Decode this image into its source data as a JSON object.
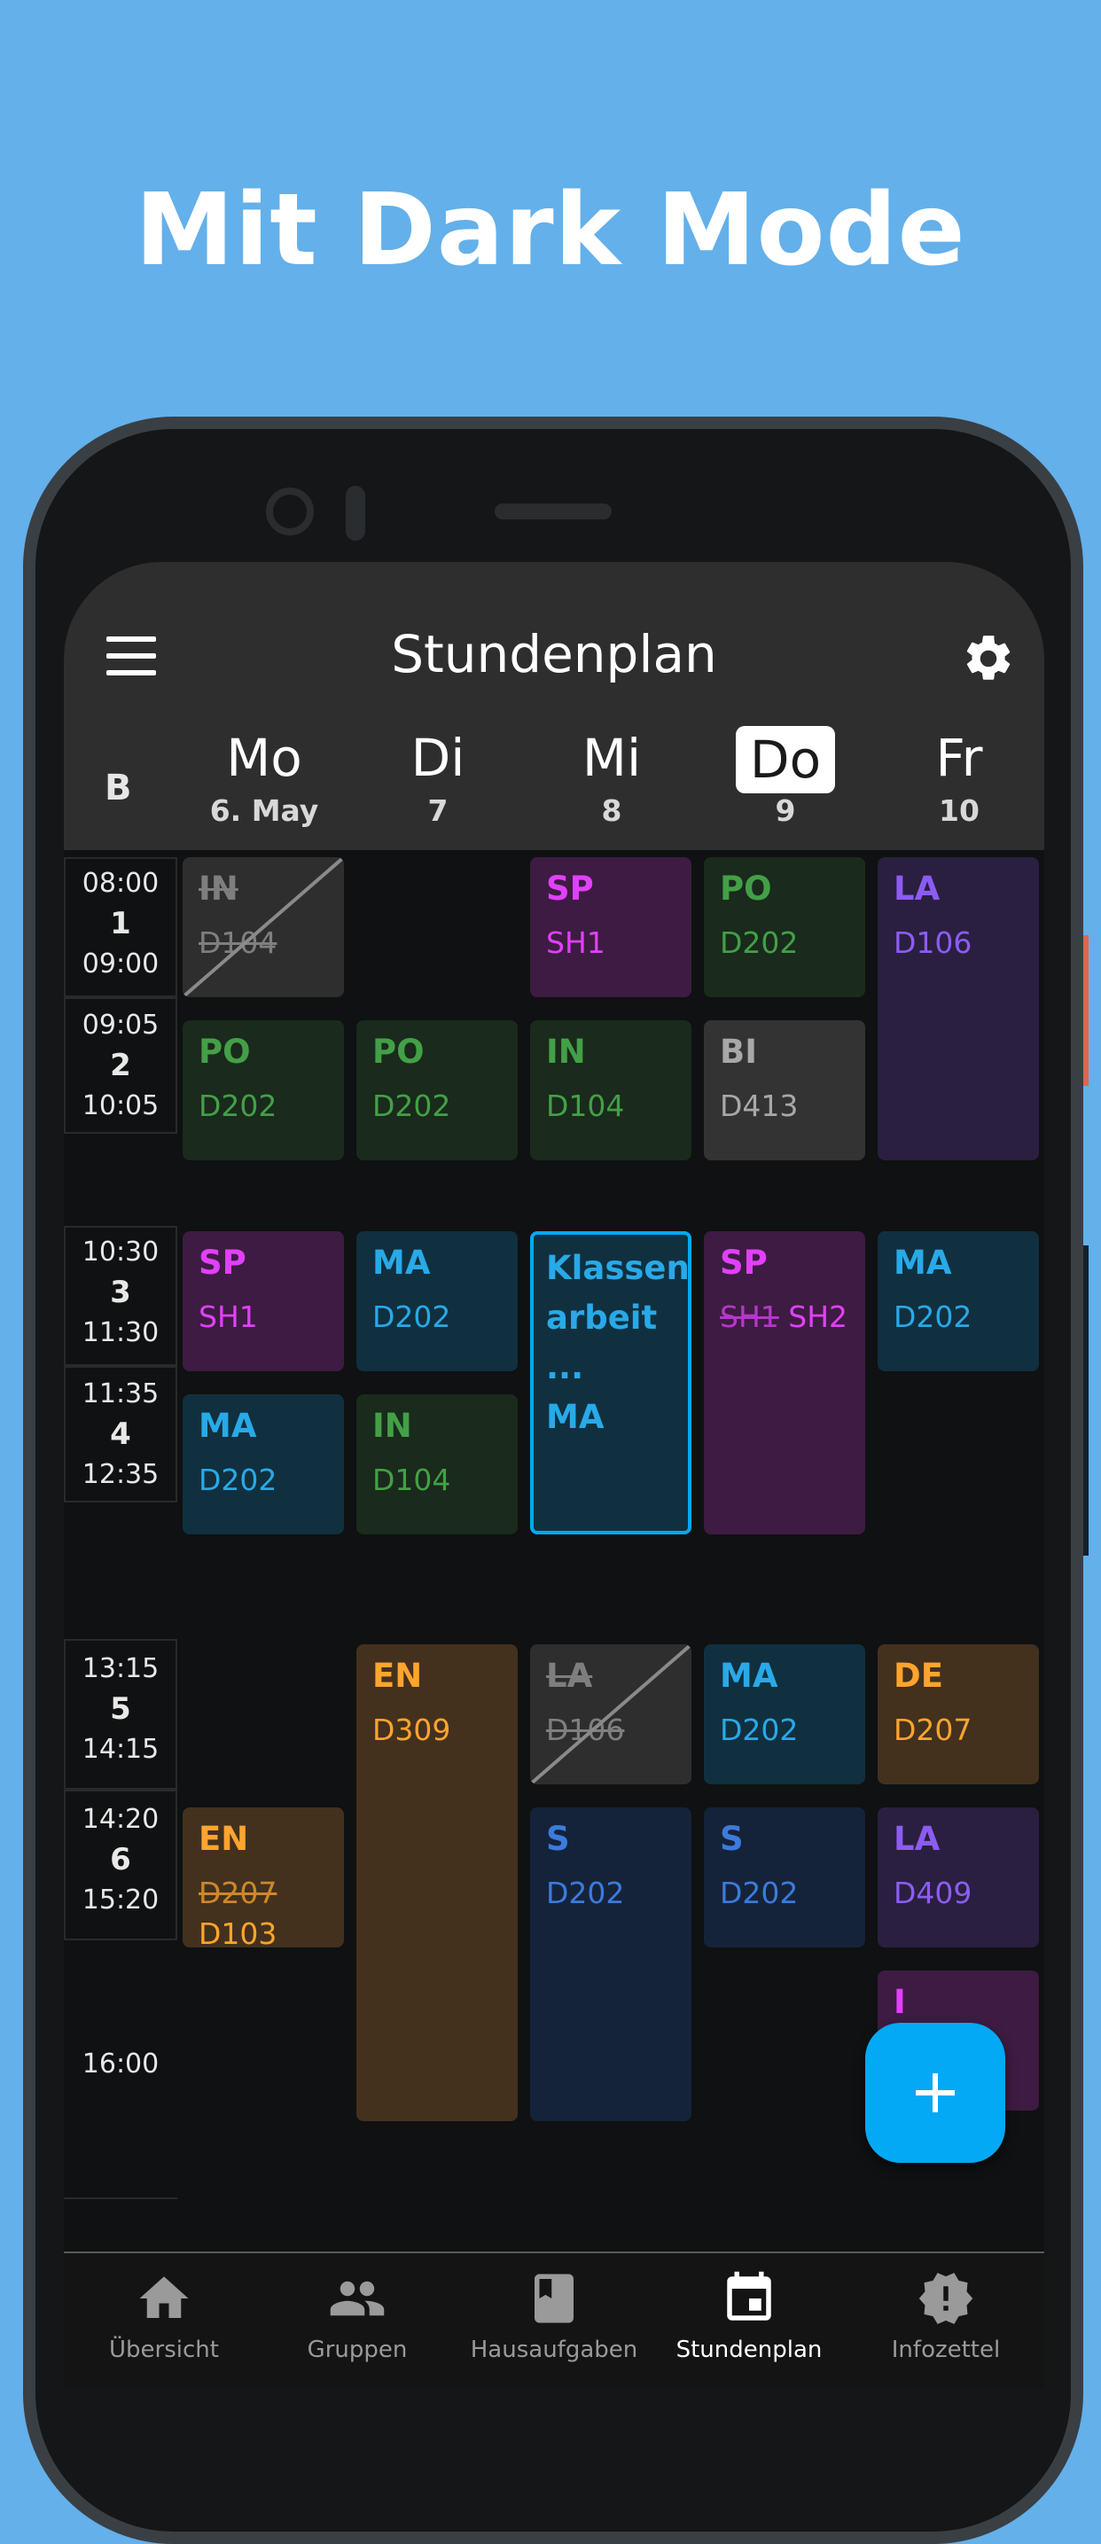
{
  "headline": "Mit Dark Mode",
  "appbar": {
    "title": "Stundenplan",
    "week_label": "B"
  },
  "days": [
    {
      "name": "Mo",
      "date": "6. May",
      "today": false
    },
    {
      "name": "Di",
      "date": "7",
      "today": false
    },
    {
      "name": "Mi",
      "date": "8",
      "today": false
    },
    {
      "name": "Do",
      "date": "9",
      "today": true
    },
    {
      "name": "Fr",
      "date": "10",
      "today": false
    }
  ],
  "periods": [
    {
      "start": "08:00",
      "num": "1",
      "end": "09:00"
    },
    {
      "start": "09:05",
      "num": "2",
      "end": "10:05"
    },
    {
      "start": "10:30",
      "num": "3",
      "end": "11:30"
    },
    {
      "start": "11:35",
      "num": "4",
      "end": "12:35"
    },
    {
      "start": "13:15",
      "num": "5",
      "end": "14:15"
    },
    {
      "start": "14:20",
      "num": "6",
      "end": "15:20"
    }
  ],
  "extra_time": "16:00",
  "lessons": {
    "mo1": {
      "subject": "IN",
      "room": "D104"
    },
    "mo2": {
      "subject": "PO",
      "room": "D202"
    },
    "mo3": {
      "subject": "SP",
      "room": "SH1"
    },
    "mo4": {
      "subject": "MA",
      "room": "D202"
    },
    "mo6": {
      "subject": "EN",
      "room_old": "D207",
      "room": "D103"
    },
    "di2": {
      "subject": "PO",
      "room": "D202"
    },
    "di3": {
      "subject": "MA",
      "room": "D202"
    },
    "di4": {
      "subject": "IN",
      "room": "D104"
    },
    "di5": {
      "subject": "EN",
      "room": "D309"
    },
    "mi1": {
      "subject": "SP",
      "room": "SH1"
    },
    "mi2": {
      "subject": "IN",
      "room": "D104"
    },
    "mi3": {
      "title_line1": "Klassen",
      "title_line2": "arbeit ...",
      "subject": "MA"
    },
    "mi5": {
      "subject": "LA",
      "room": "D106"
    },
    "mi6": {
      "subject": "S",
      "room": "D202"
    },
    "do1": {
      "subject": "PO",
      "room": "D202"
    },
    "do2": {
      "subject": "BI",
      "room": "D413"
    },
    "do3": {
      "subject": "SP",
      "room_old": "SH1",
      "room": "SH2"
    },
    "do5": {
      "subject": "MA",
      "room": "D202"
    },
    "do6": {
      "subject": "S",
      "room": "D202"
    },
    "fr1": {
      "subject": "LA",
      "room": "D106"
    },
    "fr3": {
      "subject": "MA",
      "room": "D202"
    },
    "fr5": {
      "subject": "DE",
      "room": "D207"
    },
    "fr6": {
      "subject": "LA",
      "room": "D409"
    },
    "fr7": {
      "subject": "I"
    }
  },
  "colors": {
    "background": "#64b0ea",
    "in_cancelled": "#2e2e2e",
    "po": "#1a2a1c",
    "sp": "#3e1b42",
    "ma": "#10303f",
    "en": "#43311e",
    "la": "#2a1f40",
    "s": "#15233a",
    "de": "#43311e",
    "accent": "#03a9f4"
  },
  "nav": [
    {
      "label": "Übersicht",
      "icon": "home-icon"
    },
    {
      "label": "Gruppen",
      "icon": "people-icon"
    },
    {
      "label": "Hausaufgaben",
      "icon": "book-icon"
    },
    {
      "label": "Stundenplan",
      "icon": "calendar-icon",
      "active": true
    },
    {
      "label": "Infozettel",
      "icon": "alert-badge-icon"
    }
  ]
}
